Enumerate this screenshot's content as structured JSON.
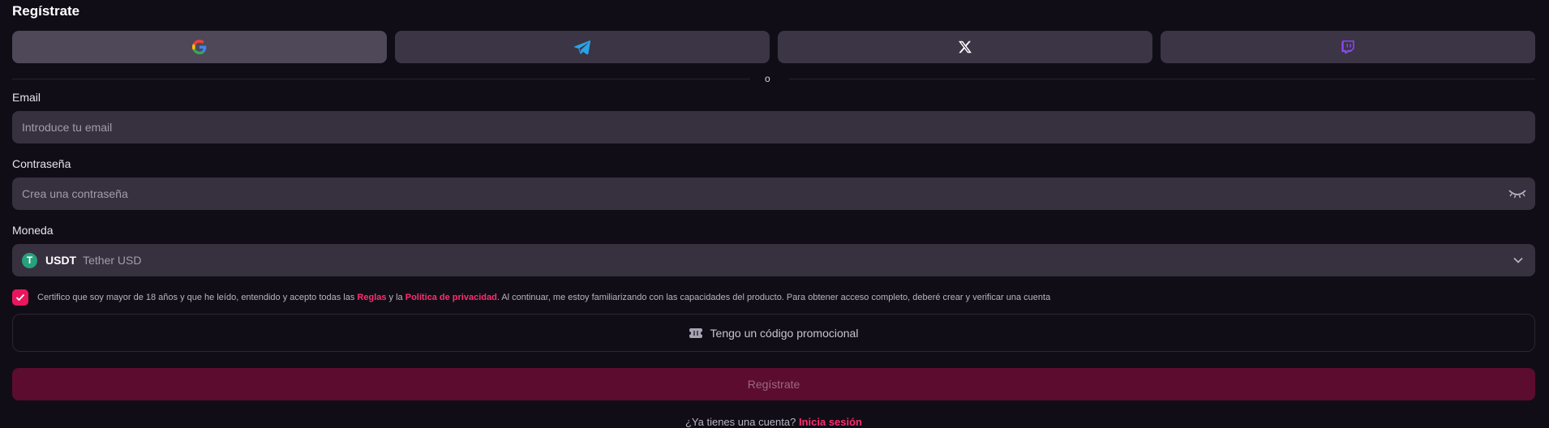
{
  "title": "Regístrate",
  "social": [
    {
      "name": "google-icon"
    },
    {
      "name": "telegram-icon"
    },
    {
      "name": "x-icon"
    },
    {
      "name": "twitch-icon"
    }
  ],
  "divider_text": "o",
  "email": {
    "label": "Email",
    "placeholder": "Introduce tu email"
  },
  "password": {
    "label": "Contraseña",
    "placeholder": "Crea una contraseña"
  },
  "currency": {
    "label": "Moneda",
    "coin_symbol": "T",
    "code": "USDT",
    "name": "Tether USD"
  },
  "terms": {
    "checked": true,
    "prefix": "Certifico que soy mayor de 18 años y que he leído, entendido y acepto todas las ",
    "rules_link": "Reglas",
    "middle": " y la ",
    "privacy_link": "Política de privacidad",
    "suffix": ". Al continuar, me estoy familiarizando con las capacidades del producto. Para obtener acceso completo, deberé crear y verificar una cuenta"
  },
  "promo_label": "Tengo un código promocional",
  "register_label": "Regístrate",
  "login": {
    "prompt": "¿Ya tienes una cuenta?",
    "link": "Inicia sesión"
  },
  "colors": {
    "accent": "#e8175d",
    "background": "#110d17",
    "field": "#37313f"
  }
}
